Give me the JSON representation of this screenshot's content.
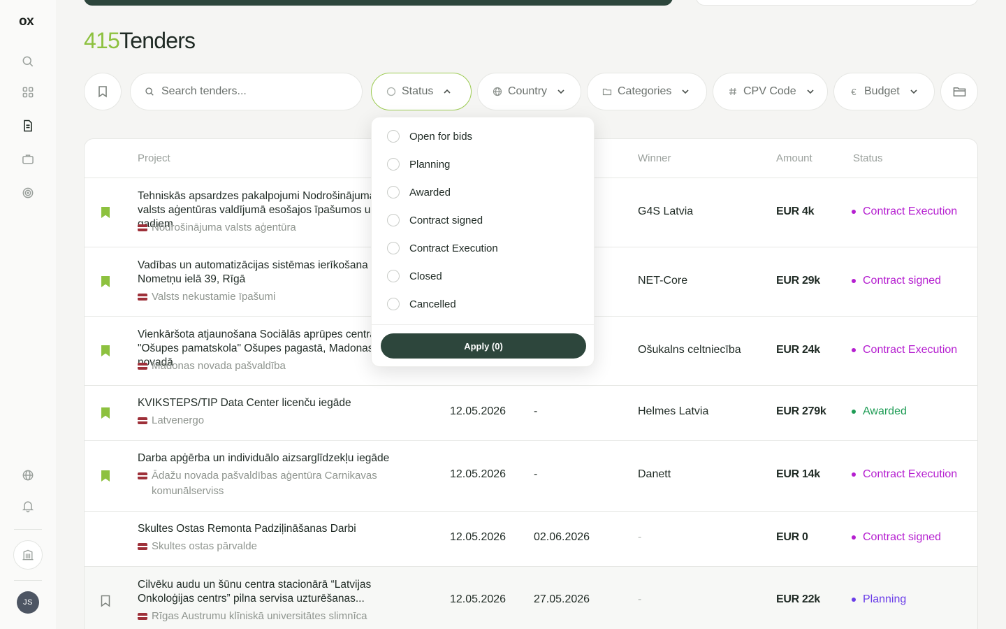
{
  "app": {
    "logo": "ox"
  },
  "user": {
    "initials": "JS"
  },
  "header": {
    "count": "415",
    "title": "Tenders"
  },
  "filters": {
    "search_placeholder": "Search tenders...",
    "status": "Status",
    "country": "Country",
    "categories": "Categories",
    "cpv": "CPV Code",
    "budget": "Budget"
  },
  "columns": {
    "project": "Project",
    "winner": "Winner",
    "amount": "Amount",
    "status": "Status"
  },
  "rows": [
    {
      "title": "Tehniskās apsardzes pakalpojumi Nodrošinājuma valsts aģentūras valdījumā esošajos īpašumos uz 2 gadiem",
      "org": "Nodrošinājuma valsts aģentūra",
      "published": "",
      "deadline": "",
      "winner": "G4S Latvia",
      "amount": "EUR 4k",
      "status": "Contract Execution",
      "saved": true
    },
    {
      "title": "Vadības un automatizācijas sistēmas ierīkošana Nometņu ielā 39, Rīgā",
      "org": "Valsts nekustamie īpašumi",
      "published": "",
      "deadline": "",
      "winner": "NET-Core",
      "amount": "EUR 29k",
      "status": "Contract signed",
      "saved": true
    },
    {
      "title": "Vienkāršota atjaunošana Sociālās aprūpes centra \"Ošupes pamatskola\" Ošupes pagastā, Madonas novadā",
      "org": "Madonas novada pašvaldība",
      "published": "",
      "deadline": "",
      "winner": "Ošukalns celtniecība",
      "amount": "EUR 24k",
      "status": "Contract Execution",
      "saved": true
    },
    {
      "title": "KVIKSTEPS/TIP Data Center licenču iegāde",
      "org": "Latvenergo",
      "published": "12.05.2026",
      "deadline": "-",
      "winner": "Helmes Latvia",
      "amount": "EUR 279k",
      "status": "Awarded",
      "saved": true
    },
    {
      "title": "Darba apģērba un individuālo aizsarglīdzekļu iegāde",
      "org": "Ādažu novada pašvaldības aģentūra Carnikavas komunālserviss",
      "published": "12.05.2026",
      "deadline": "-",
      "winner": "Danett",
      "amount": "EUR 14k",
      "status": "Contract Execution",
      "saved": true
    },
    {
      "title": "Skultes Ostas Remonta Padziļināšanas Darbi",
      "org": "Skultes ostas pārvalde",
      "published": "12.05.2026",
      "deadline": "02.06.2026",
      "winner": "-",
      "amount": "EUR 0",
      "status": "Contract signed",
      "saved": false
    },
    {
      "title": "Cilvēku audu un šūnu centra stacionārā “Latvijas Onkoloģijas centrs” pilna servisa uzturēšanas...",
      "org": "Rīgas Austrumu klīniskā universitātes slimnīca",
      "published": "12.05.2026",
      "deadline": "27.05.2026",
      "winner": "-",
      "amount": "EUR 22k",
      "status": "Planning",
      "saved": false
    }
  ],
  "status_colors": {
    "Contract Execution": "#b51fd0",
    "Contract signed": "#b51fd0",
    "Awarded": "#1e9c55",
    "Planning": "#6a3de8"
  },
  "dropdown": {
    "options": [
      "Open for bids",
      "Planning",
      "Awarded",
      "Contract signed",
      "Contract Execution",
      "Closed",
      "Cancelled"
    ],
    "apply_label": "Apply (0)"
  },
  "colors": {
    "accent_green": "#8dc13f",
    "primary_dark": "#2d463c"
  }
}
